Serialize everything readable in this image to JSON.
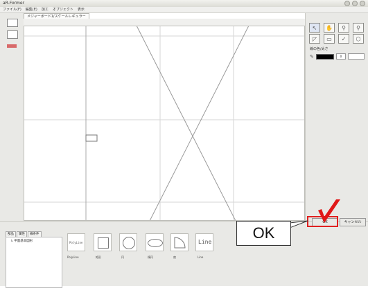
{
  "window": {
    "title": "aR-Former"
  },
  "menu": [
    "ファイル(F)",
    "編集(E)",
    "加工",
    "オブジェクト",
    "表示"
  ],
  "canvas_tab": "メジャーボード1/スケールレギュラー",
  "properties": {
    "label": "線の色/太さ",
    "size_value": "0"
  },
  "bottom_tabs": [
    "部品",
    "属性",
    "線条件"
  ],
  "tree_item": "↳ 平面基本図形",
  "shapes": [
    "PolyLine",
    "矩形",
    "円",
    "楕円",
    "扇",
    "Line"
  ],
  "shape_glyph_line": "Line",
  "shape_glyph_polyline": "PolyLine",
  "buttons": {
    "ok": "OK",
    "cancel": "キャンセル"
  },
  "callout": {
    "text": "OK"
  }
}
